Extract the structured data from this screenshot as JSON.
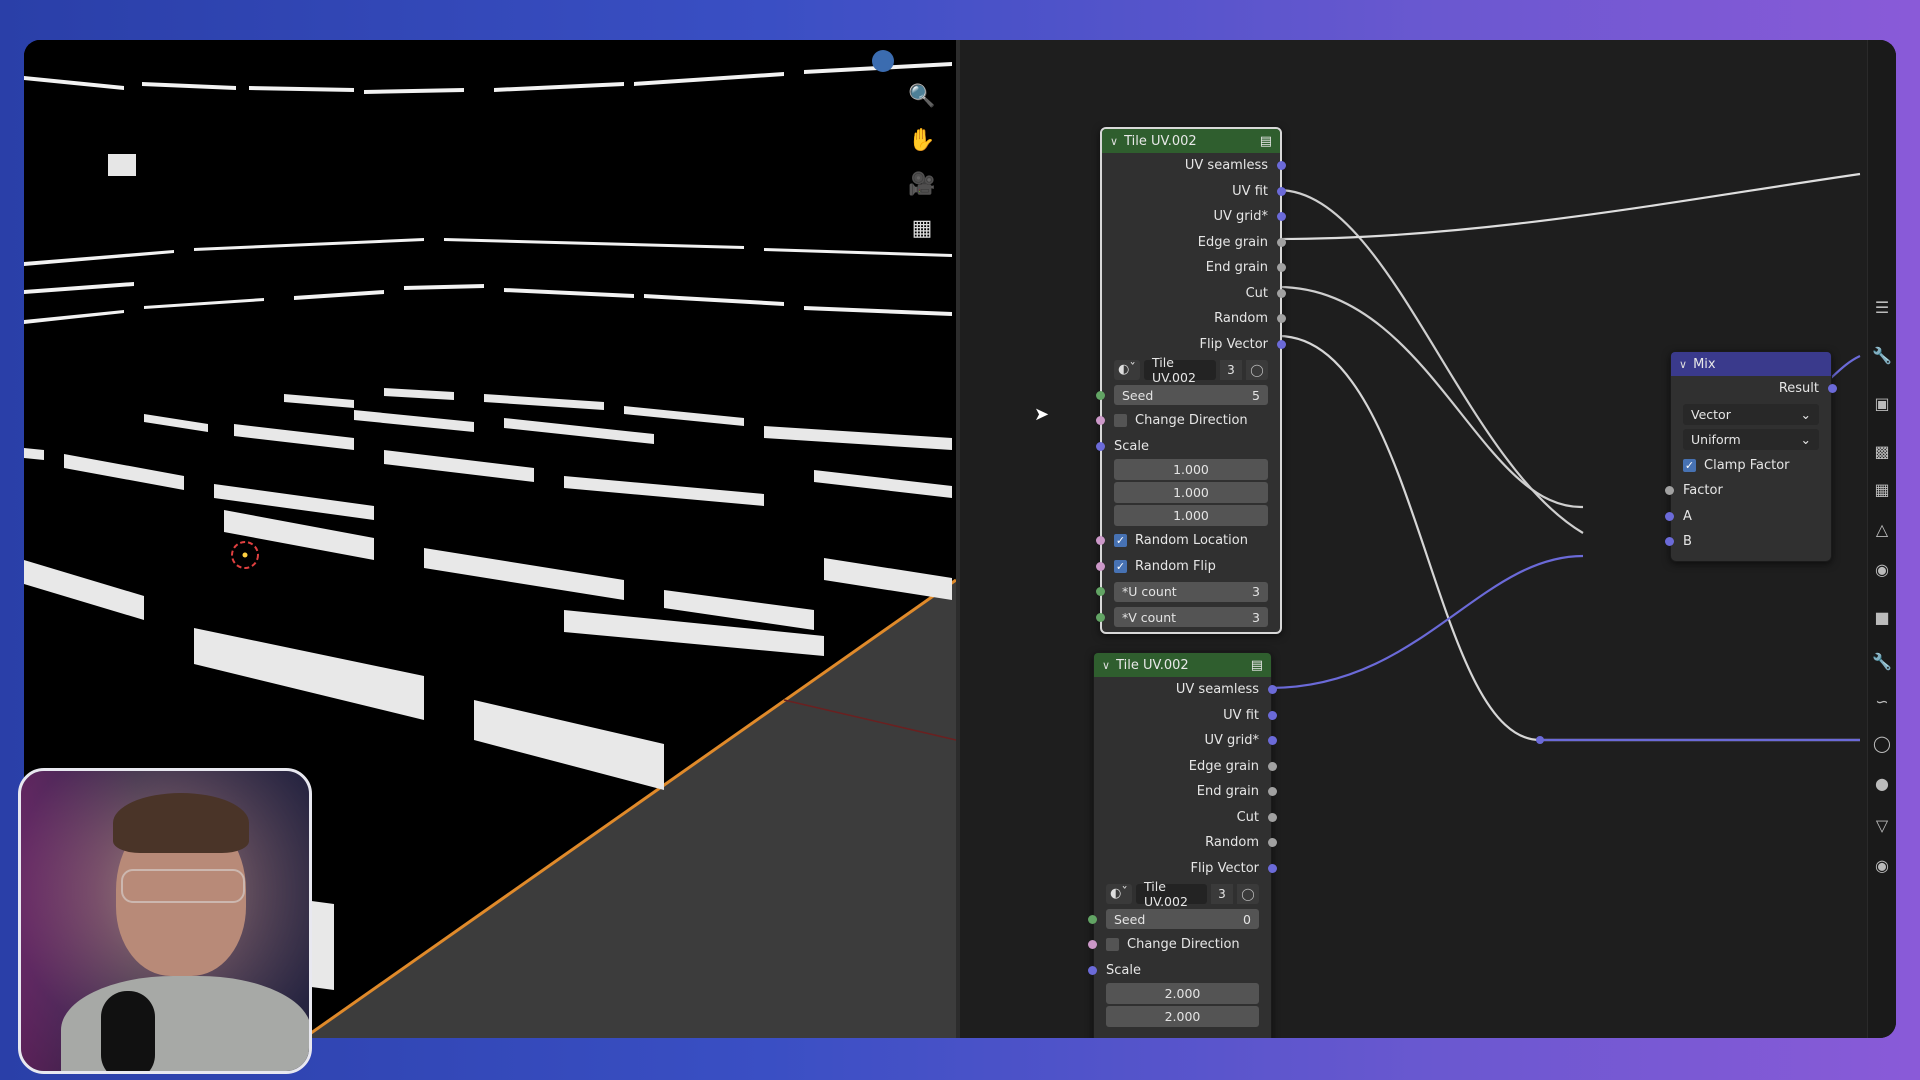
{
  "colors": {
    "node_border": "#d8d8d8",
    "header_green": "#2f5e2e",
    "header_mix": "#3a3a8c",
    "socket_vector": "#6b6ad8",
    "socket_float": "#a1a1a1",
    "socket_int": "#62a464",
    "socket_bool": "#cc98c8",
    "checkbox_on": "#4772b3"
  },
  "viewport": {
    "tools": [
      "zoom-icon",
      "hand-pan-icon",
      "camera-icon",
      "grid-icon"
    ]
  },
  "node1": {
    "title": "Tile UV.002",
    "outputs": [
      "UV seamless",
      "UV fit",
      "UV grid*",
      "Edge grain",
      "End grain",
      "Cut",
      "Random",
      "Flip Vector"
    ],
    "datablock": {
      "name": "Tile UV.002",
      "users": "3"
    },
    "seed": {
      "label": "Seed",
      "value": "5"
    },
    "change_direction": "Change Direction",
    "scale_label": "Scale",
    "scale": [
      "1.000",
      "1.000",
      "1.000"
    ],
    "random_location": "Random Location",
    "random_flip": "Random Flip",
    "u_count": {
      "label": "*U count",
      "value": "3"
    },
    "v_count": {
      "label": "*V count",
      "value": "3"
    }
  },
  "node2": {
    "title": "Tile UV.002",
    "outputs": [
      "UV seamless",
      "UV fit",
      "UV grid*",
      "Edge grain",
      "End grain",
      "Cut",
      "Random",
      "Flip Vector"
    ],
    "datablock": {
      "name": "Tile UV.002",
      "users": "3"
    },
    "seed": {
      "label": "Seed",
      "value": "0"
    },
    "change_direction": "Change Direction",
    "scale_label": "Scale",
    "scale": [
      "2.000",
      "2.000"
    ]
  },
  "mix": {
    "title": "Mix",
    "result": "Result",
    "data_type": "Vector",
    "factor_mode": "Uniform",
    "clamp_factor": "Clamp Factor",
    "inputs": [
      "Factor",
      "A",
      "B"
    ]
  }
}
